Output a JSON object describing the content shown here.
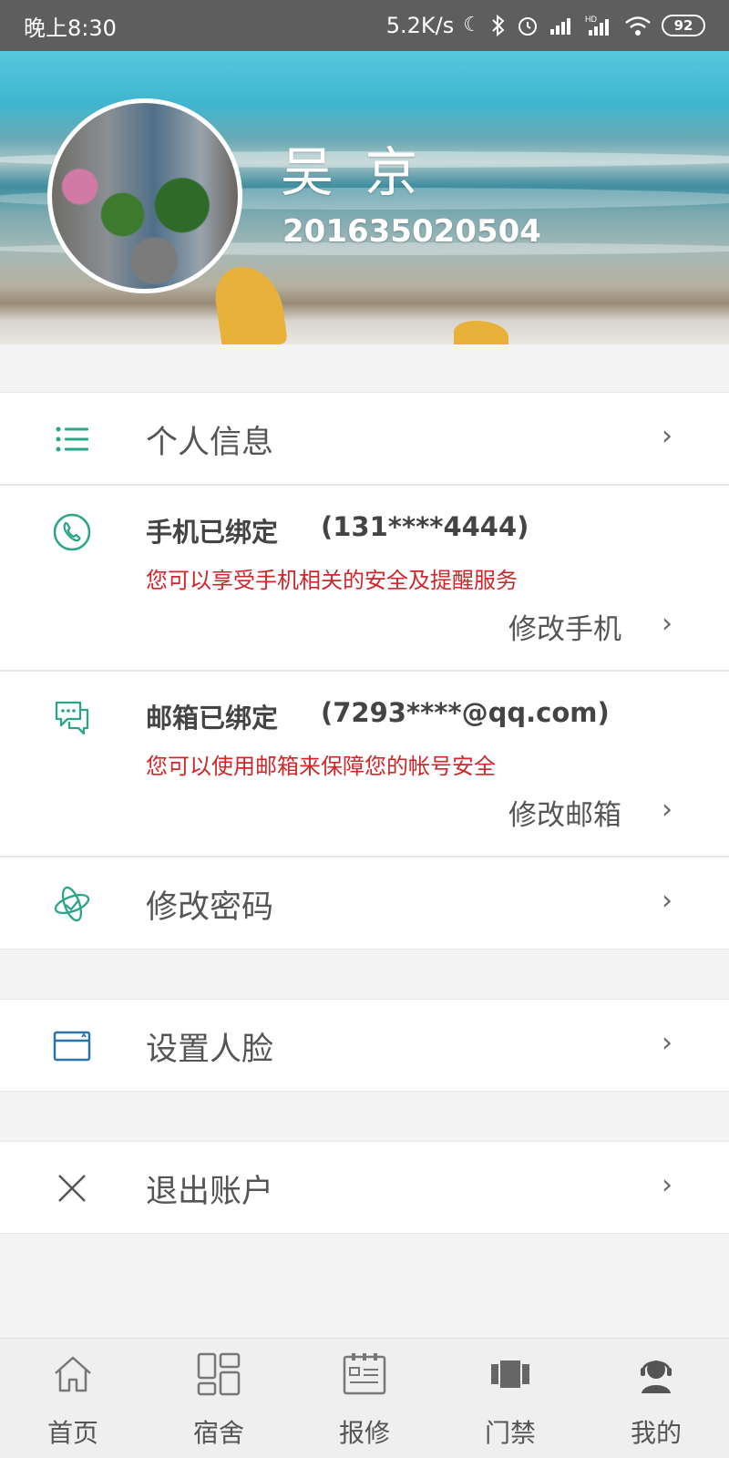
{
  "status_bar": {
    "time": "晚上8:30",
    "speed": "5.2K/s",
    "battery": "92",
    "icons": [
      "moon-icon",
      "bluetooth-icon",
      "alarm-icon",
      "signal-icon",
      "hd-signal-icon",
      "wifi-icon",
      "battery-icon"
    ]
  },
  "profile": {
    "name": "吴 京",
    "id": "201635020504"
  },
  "menu": {
    "personal_info": "个人信息",
    "phone": {
      "title": "手机已绑定",
      "value": "(131****4444)",
      "desc": "您可以享受手机相关的安全及提醒服务",
      "action": "修改手机"
    },
    "email": {
      "title": "邮箱已绑定",
      "value": "(7293****@qq.com)",
      "desc": "您可以使用邮箱来保障您的帐号安全",
      "action": "修改邮箱"
    },
    "change_password": "修改密码",
    "set_face": "设置人脸",
    "logout": "退出账户",
    "chevron": "›"
  },
  "bottom_nav": {
    "items": [
      {
        "label": "首页",
        "icon": "home-icon"
      },
      {
        "label": "宿舍",
        "icon": "dorm-icon"
      },
      {
        "label": "报修",
        "icon": "repair-icon"
      },
      {
        "label": "门禁",
        "icon": "access-control-icon"
      },
      {
        "label": "我的",
        "icon": "profile-icon"
      }
    ]
  },
  "colors": {
    "accent": "#2aa58a",
    "warning_text": "#d0262a",
    "card_blue": "#2c74a8"
  }
}
